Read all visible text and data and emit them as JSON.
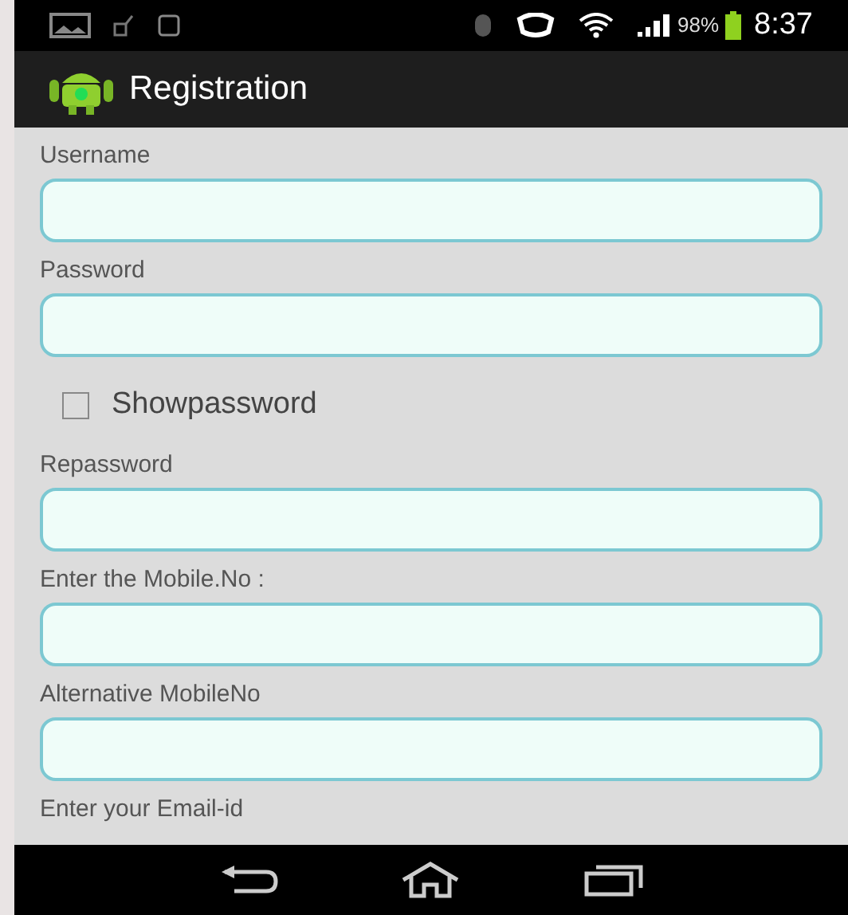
{
  "status_bar": {
    "battery": "98%",
    "time": "8:37"
  },
  "action_bar": {
    "title": "Registration"
  },
  "form": [
    {
      "kind": "field",
      "label": "Username"
    },
    {
      "kind": "field",
      "label": "Password"
    },
    {
      "kind": "checkbox",
      "label": "Showpassword",
      "checked": false
    },
    {
      "kind": "field",
      "label": "Repassword"
    },
    {
      "kind": "field",
      "label": "Enter the Mobile.No :"
    },
    {
      "kind": "field",
      "label": "Alternative MobileNo"
    },
    {
      "kind": "label",
      "label": "Enter your Email-id"
    }
  ]
}
